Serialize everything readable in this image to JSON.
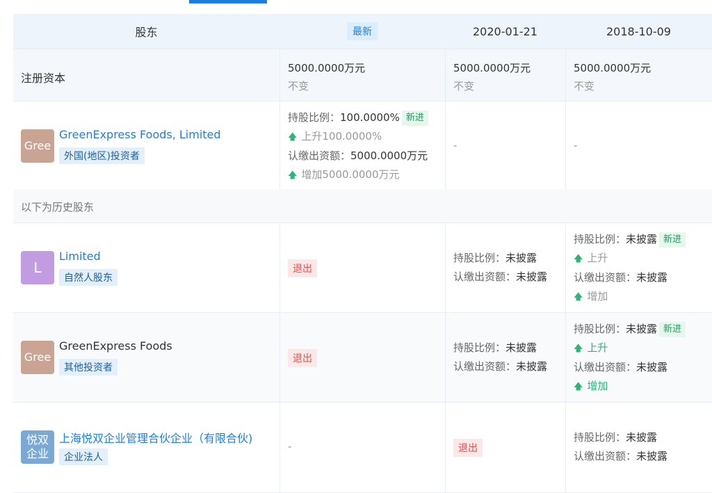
{
  "header": {
    "col_shareholder": "股东",
    "col_latest_badge": "最新",
    "col_date1": "2020-01-21",
    "col_date2": "2018-10-09"
  },
  "registered_capital": {
    "label": "注册资本",
    "latest": {
      "value": "5000.0000万元",
      "change": "不变"
    },
    "date1": {
      "value": "5000.0000万元",
      "change": "不变"
    },
    "date2": {
      "value": "5000.0000万元",
      "change": "不变"
    }
  },
  "labels": {
    "ratio": "持股比例：",
    "contribution": "认缴出资额：",
    "new_in": "新进",
    "exit": "退出",
    "dash": "-",
    "up_arrow": "🡅",
    "undisclosed": "未披露",
    "rise": "上升",
    "increase": "增加"
  },
  "current_shareholders": [
    {
      "avatar_text": "Gree",
      "avatar_color": "#c9a493",
      "name": "GreenExpress Foods, Limited",
      "type": "外国(地区)投资者",
      "latest": {
        "ratio": "100.0000%",
        "ratio_change": "上升100.0000%",
        "contribution": "5000.0000万元",
        "contribution_change": "增加5000.0000万元"
      },
      "date1": "-",
      "date2": "-"
    }
  ],
  "history_label": "以下为历史股东",
  "history_shareholders": [
    {
      "avatar_text": "L",
      "avatar_color": "#c39be0",
      "name": "Limited",
      "type": "自然人股东"
    },
    {
      "avatar_text": "Gree",
      "avatar_color": "#c9a493",
      "name": "GreenExpress Foods",
      "type": "其他投资者"
    },
    {
      "avatar_text": "悦双企业",
      "avatar_color": "#7aa9d6",
      "name": "上海悦双企业管理合伙企业（有限合伙)",
      "type": "企业法人"
    }
  ]
}
